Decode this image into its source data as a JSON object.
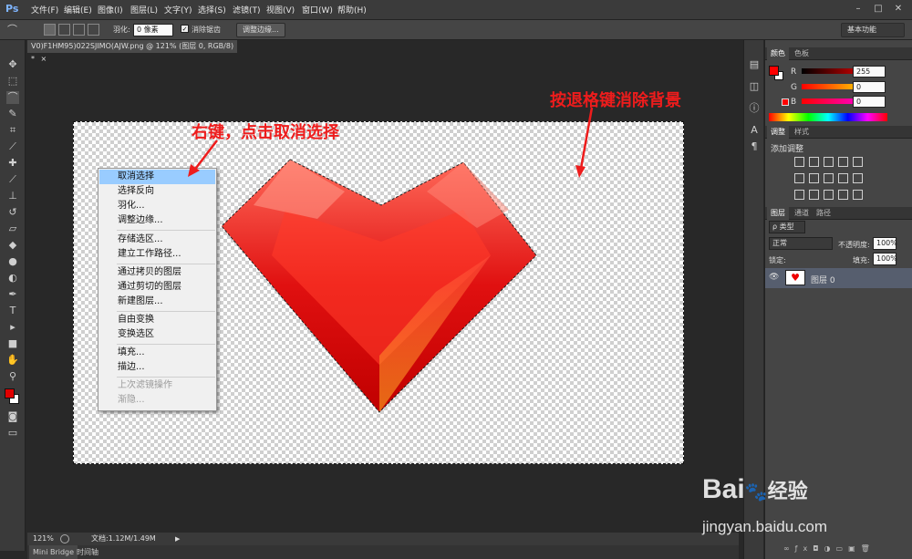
{
  "app": {
    "logo": "Ps"
  },
  "menu": [
    "文件(F)",
    "编辑(E)",
    "图像(I)",
    "图层(L)",
    "文字(Y)",
    "选择(S)",
    "滤镜(T)",
    "视图(V)",
    "窗口(W)",
    "帮助(H)"
  ],
  "window_controls": {
    "minimize": "–",
    "restore": "□",
    "close": "✕"
  },
  "options": {
    "feather_label": "羽化:",
    "feather_value": "0 像素",
    "antialias_label": "消除锯齿",
    "refine_edge": "调整边缘...",
    "workspace": "基本功能"
  },
  "document": {
    "tab_title": "V0)F1HM95)022SJIMO(AJW.png @ 121% (图层 0, RGB/8) *",
    "close": "×"
  },
  "context_menu": {
    "items": [
      {
        "label": "取消选择",
        "selected": true,
        "disabled": false
      },
      {
        "label": "选择反向",
        "selected": false,
        "disabled": false
      },
      {
        "label": "羽化...",
        "selected": false,
        "disabled": false
      },
      {
        "label": "调整边缘...",
        "selected": false,
        "disabled": false
      },
      {
        "label": "存储选区...",
        "selected": false,
        "disabled": false
      },
      {
        "label": "建立工作路径...",
        "selected": false,
        "disabled": false
      },
      {
        "label": "通过拷贝的图层",
        "selected": false,
        "disabled": false
      },
      {
        "label": "通过剪切的图层",
        "selected": false,
        "disabled": false
      },
      {
        "label": "新建图层...",
        "selected": false,
        "disabled": false
      },
      {
        "label": "自由变换",
        "selected": false,
        "disabled": false
      },
      {
        "label": "变换选区",
        "selected": false,
        "disabled": false
      },
      {
        "label": "填充...",
        "selected": false,
        "disabled": false
      },
      {
        "label": "描边...",
        "selected": false,
        "disabled": false
      },
      {
        "label": "上次滤镜操作",
        "selected": false,
        "disabled": true
      },
      {
        "label": "渐隐...",
        "selected": false,
        "disabled": true
      }
    ]
  },
  "annotations": {
    "right_click": "右键，点击取消选择",
    "backspace": "按退格键消除背景"
  },
  "status": {
    "zoom": "121%",
    "doc_info": "文档:1.12M/1.49M"
  },
  "bottom_tabs": [
    "Mini Bridge",
    "时间轴"
  ],
  "color_panel": {
    "tabs": [
      "颜色",
      "色板"
    ],
    "channels": [
      {
        "label": "R",
        "value": "255"
      },
      {
        "label": "G",
        "value": "0"
      },
      {
        "label": "B",
        "value": "0"
      }
    ],
    "foreground": "#ff0000"
  },
  "adjust_panel": {
    "tabs": [
      "调整",
      "样式"
    ],
    "title": "添加调整"
  },
  "layers_panel": {
    "tabs": [
      "图层",
      "通道",
      "路径"
    ],
    "filter": "ρ 类型",
    "blend_mode": "正常",
    "opacity_label": "不透明度:",
    "opacity_value": "100%",
    "lock_label": "锁定:",
    "fill_label": "填充:",
    "fill_value": "100%",
    "layer_name": "图层 0"
  },
  "watermark": {
    "brand": "Bai",
    "brand2": "经验",
    "url": "jingyan.baidu.com"
  },
  "colors": {
    "accent_red": "#ee1c1c",
    "menu_highlight": "#99ccff"
  }
}
